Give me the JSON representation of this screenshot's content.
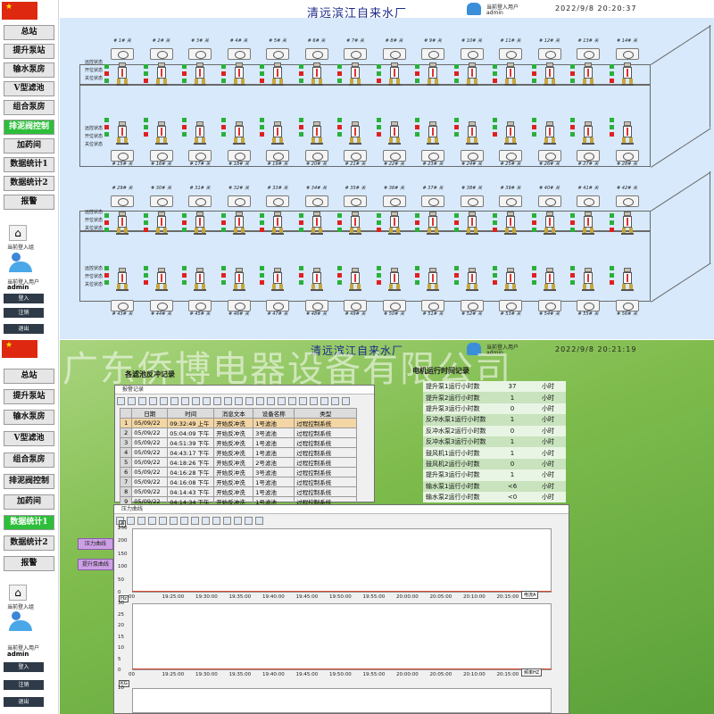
{
  "colors": {
    "accent_green": "#2dbf3a",
    "title_blue": "#1a2a8a",
    "led_red": "#e02020",
    "led_green": "#2ab03a",
    "led_gray": "#9a9a9a",
    "trace": "#d4472f"
  },
  "panel1": {
    "title": "清远滨江自来水厂",
    "user_label": "当前登入用户",
    "user_name": "admin",
    "datetime": "2022/9/8 20:20:37",
    "nav": [
      "总站",
      "提升泵站",
      "输水泵房",
      "V型滤池",
      "组合泵房",
      "排泥阀控制",
      "加药间",
      "数据统计1",
      "数据统计2",
      "报警"
    ],
    "active_nav": 5,
    "login_group_label": "当前登入组",
    "current_user_label": "当前登入用户",
    "current_user": "admin",
    "buttons": [
      "登入",
      "注销",
      "退出"
    ],
    "status_labels": [
      "远控状态",
      "开位状态",
      "关位状态"
    ],
    "row1_labels": [
      "# 1# 关",
      "# 2# 关",
      "# 3# 关",
      "# 4# 关",
      "# 5# 关",
      "# 6# 关",
      "# 7# 关",
      "# 8# 关",
      "# 9# 关",
      "# 10# 关",
      "# 11# 关",
      "# 12# 关",
      "# 13# 关",
      "# 14# 关"
    ],
    "row2_labels": [
      "# 15# 关",
      "# 16# 关",
      "# 17# 关",
      "# 18# 关",
      "# 19# 关",
      "# 20# 关",
      "# 21# 关",
      "# 22# 关",
      "# 23# 关",
      "# 24# 关",
      "# 25# 关",
      "# 26# 关",
      "# 27# 关",
      "# 28# 关"
    ],
    "row3_labels": [
      "# 29# 关",
      "# 30# 关",
      "# 31# 关",
      "# 32# 关",
      "# 33# 关",
      "# 34# 关",
      "# 35# 关",
      "# 36# 关",
      "# 37# 关",
      "# 38# 关",
      "# 39# 关",
      "# 40# 关",
      "# 41# 关",
      "# 42# 关"
    ],
    "row4_labels": [
      "# 43# 关",
      "# 44# 关",
      "# 45# 关",
      "# 46# 关",
      "# 47# 关",
      "# 48# 关",
      "# 49# 关",
      "# 50# 关",
      "# 51# 关",
      "# 52# 关",
      "# 53# 关",
      "# 54# 关",
      "# 55# 关",
      "# 56# 关"
    ]
  },
  "panel2": {
    "title": "清远滨江自来水厂",
    "watermark": "广东侨博电器设备有限公司",
    "user_label": "当前登入用户",
    "user_name": "admin",
    "datetime": "2022/9/8 20:21:19",
    "nav": [
      "总站",
      "提升泵站",
      "输水泵房",
      "V型滤池",
      "组合泵房",
      "排泥阀控制",
      "加药间",
      "数据统计1",
      "数据统计2",
      "报警"
    ],
    "active_nav": 7,
    "login_group_label": "当前登入组",
    "current_user_label": "当前登入用户",
    "current_user": "admin",
    "buttons": [
      "登入",
      "注销",
      "退出"
    ],
    "backwash_header": "各滤池反冲记录",
    "backwash_window_title": "报警记录",
    "backwash_columns": [
      "",
      "日期",
      "时间",
      "消息文本",
      "设备名称",
      "类型"
    ],
    "backwash_rows": [
      [
        "1",
        "05/09/22",
        "09:32:49 上午",
        "开始反冲洗",
        "1号滤池",
        "过程控制系统"
      ],
      [
        "2",
        "05/09/22",
        "05:04:09 下午",
        "开始反冲洗",
        "3号滤池",
        "过程控制系统"
      ],
      [
        "3",
        "05/09/22",
        "04:51:39 下午",
        "开始反冲洗",
        "1号滤池",
        "过程控制系统"
      ],
      [
        "4",
        "05/09/22",
        "04:43:17 下午",
        "开始反冲洗",
        "1号滤池",
        "过程控制系统"
      ],
      [
        "5",
        "05/09/22",
        "04:18:26 下午",
        "开始反冲洗",
        "2号滤池",
        "过程控制系统"
      ],
      [
        "6",
        "05/09/22",
        "04:16:28 下午",
        "开始反冲洗",
        "3号滤池",
        "过程控制系统"
      ],
      [
        "7",
        "05/09/22",
        "04:16:08 下午",
        "开始反冲洗",
        "1号滤池",
        "过程控制系统"
      ],
      [
        "8",
        "05/09/22",
        "04:14:43 下午",
        "开始反冲洗",
        "1号滤池",
        "过程控制系统"
      ],
      [
        "9",
        "05/09/22",
        "04:14:34 下午",
        "开始反冲洗",
        "1号滤池",
        "过程控制系统"
      ],
      [
        "10",
        "05/09/22",
        "04:13:18 下午",
        "开始反冲洗",
        "1号滤池",
        "过程控制系统"
      ],
      [
        "11",
        "05/09/22",
        "04:13:17 下午",
        "开始反冲洗",
        "1号滤池",
        "过程控制系统"
      ]
    ],
    "runtime_header": "电机运行时间记录",
    "runtime_rows": [
      {
        "name": "提升泵1运行小时数",
        "value": "37",
        "unit": "小时"
      },
      {
        "name": "提升泵2运行小时数",
        "value": "1",
        "unit": "小时"
      },
      {
        "name": "提升泵3运行小时数",
        "value": "0",
        "unit": "小时"
      },
      {
        "name": "反冲水泵1运行小时数",
        "value": "1",
        "unit": "小时"
      },
      {
        "name": "反冲水泵2运行小时数",
        "value": "0",
        "unit": "小时"
      },
      {
        "name": "反冲水泵3运行小时数",
        "value": "1",
        "unit": "小时"
      },
      {
        "name": "鼓风机1运行小时数",
        "value": "1",
        "unit": "小时"
      },
      {
        "name": "鼓风机2运行小时数",
        "value": "0",
        "unit": "小时"
      },
      {
        "name": "提升泵3运行小时数",
        "value": "1",
        "unit": "小时"
      },
      {
        "name": "输水泵1运行小时数",
        "value": "<6",
        "unit": "小时"
      },
      {
        "name": "输水泵2运行小时数",
        "value": "<0",
        "unit": "小时"
      }
    ],
    "curve_buttons": [
      "压力曲线",
      "提升泵曲线"
    ],
    "trend_window_title": "压力曲线",
    "plot1": {
      "y_ticks": [
        "250",
        "200",
        "150",
        "100",
        "50",
        "0"
      ],
      "unit": "A",
      "legend": "电流A"
    },
    "plot2": {
      "y_ticks": [
        "30",
        "25",
        "20",
        "15",
        "10",
        "5",
        "0"
      ],
      "unit": "Hz",
      "legend": "频率HZ"
    },
    "plot3": {
      "y_ticks": [
        "10"
      ],
      "unit": "KG"
    },
    "x_ticks": [
      "00",
      "19:25:00",
      "19:30:00",
      "19:35:00",
      "19:40:00",
      "19:45:00",
      "19:50:00",
      "19:55:00",
      "20:00:00",
      "20:05:00",
      "20:10:00",
      "20:15:00",
      "00"
    ]
  }
}
